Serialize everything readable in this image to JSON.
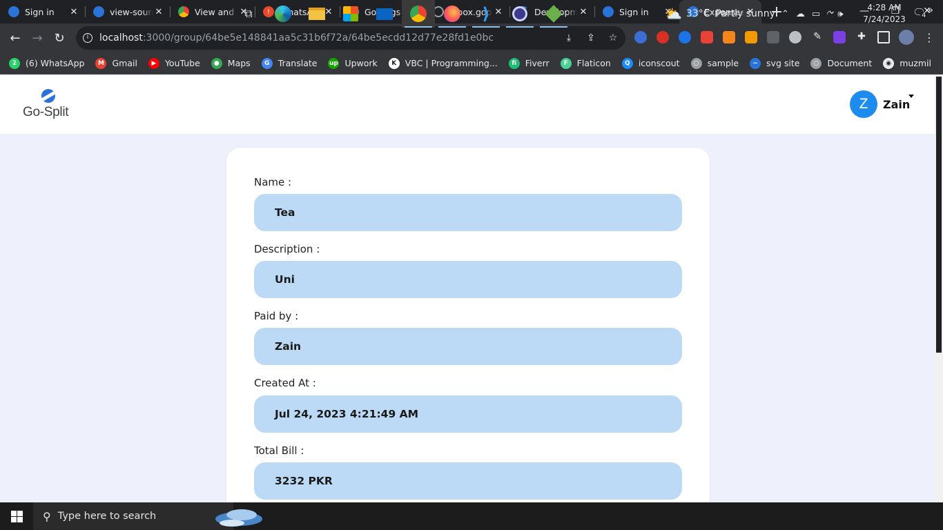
{
  "browser": {
    "tabs": [
      {
        "title": "Sign in",
        "icon_color": "#2a74d9",
        "icon": "go-split-icon"
      },
      {
        "title": "view-source",
        "icon_color": "#2a74d9",
        "icon": "go-split-icon"
      },
      {
        "title": "View and edit",
        "icon_color": "#34a853",
        "icon": "chrome-icon"
      },
      {
        "title": "WhatsApp",
        "icon_color": "#e8492c",
        "icon": "alert-icon"
      },
      {
        "title": "Goprogs Co",
        "icon_color": "#3aa7c1",
        "icon": "goprogs-icon"
      },
      {
        "title": "inbox.goprogs",
        "icon_color": "#9aa0a6",
        "icon": "globe-icon"
      },
      {
        "title": "Development",
        "icon_color": "#2a74d9",
        "icon": "loading-icon"
      },
      {
        "title": "Sign in",
        "icon_color": "#2a74d9",
        "icon": "go-split-icon"
      },
      {
        "title": "Expenses Details",
        "icon_color": "#2a74d9",
        "icon": "go-split-icon"
      }
    ],
    "url_host": "localhost",
    "url_path": ":3000/group/64be5e148841aa5c31b6f72a/64be5ecdd12d77e28fd1e0bc",
    "bookmarks": [
      {
        "label": "(6) WhatsApp",
        "icon_color": "#25d366",
        "glyph": "2"
      },
      {
        "label": "Gmail",
        "icon_color": "#ea4335",
        "glyph": "M"
      },
      {
        "label": "YouTube",
        "icon_color": "#ff0000",
        "glyph": "▶"
      },
      {
        "label": "Maps",
        "icon_color": "#34a853",
        "glyph": "●"
      },
      {
        "label": "Translate",
        "icon_color": "#4285f4",
        "glyph": "G"
      },
      {
        "label": "Upwork",
        "icon_color": "#14a800",
        "glyph": "up"
      },
      {
        "label": "VBC | Programming...",
        "icon_color": "#ffffff",
        "glyph": "K"
      },
      {
        "label": "Fiverr",
        "icon_color": "#1dbf73",
        "glyph": "fi"
      },
      {
        "label": "Flaticon",
        "icon_color": "#4ad295",
        "glyph": "F"
      },
      {
        "label": "iconscout",
        "icon_color": "#1a8cff",
        "glyph": "Q"
      },
      {
        "label": "sample",
        "icon_color": "#9aa0a6",
        "glyph": "○"
      },
      {
        "label": "svg site",
        "icon_color": "#2a74d9",
        "glyph": "~"
      },
      {
        "label": "Document",
        "icon_color": "#9aa0a6",
        "glyph": "○"
      },
      {
        "label": "muzmil",
        "icon_color": "#e8eaed",
        "glyph": "◉"
      }
    ]
  },
  "app": {
    "logo_text": "Go-Split",
    "user_initial": "Z",
    "user_name": "Zain",
    "brand_color": "#2a74d9",
    "field_bg": "#bcdaf5"
  },
  "expense": {
    "fields": [
      {
        "label": "Name :",
        "value": "Tea"
      },
      {
        "label": "Description :",
        "value": "Uni"
      },
      {
        "label": "Paid by :",
        "value": "Zain"
      },
      {
        "label": "Created At :",
        "value": "Jul 24, 2023 4:21:49 AM"
      },
      {
        "label": "Total Bill :",
        "value": "3232 PKR"
      }
    ]
  },
  "taskbar": {
    "search_placeholder": "Type here to search",
    "weather_temp": "33°C",
    "weather_text": "Partly sunny",
    "time": "4:28 AM",
    "date": "7/24/2023",
    "notification_count": "4"
  }
}
